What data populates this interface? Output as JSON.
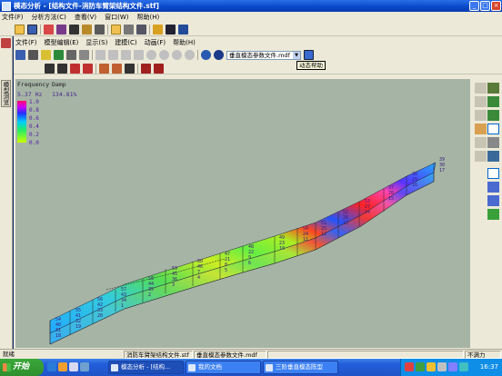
{
  "window": {
    "title": "模态分析 - [结构文件-消防车臂架结构文件.stf]"
  },
  "main_menu": [
    "文件(F)",
    "分析方法(C)",
    "查看(V)",
    "窗口(W)",
    "帮助(H)"
  ],
  "left_tab": {
    "label": "模型浏览"
  },
  "child_menu": [
    "文件(F)",
    "模型编辑(E)",
    "显示(S)",
    "建模(C)",
    "动画(F)",
    "帮助(H)"
  ],
  "mode_select": {
    "value": "垂直模态参数文件.mdf"
  },
  "tooltip": "动态帮助",
  "legend": {
    "col1": "Frequency",
    "col2": "Damp",
    "freq_value": "5.37 Hz",
    "damp_value": "134.81%",
    "ticks": [
      "1.0",
      "0.8",
      "0.6",
      "0.4",
      "0.2",
      "0.0"
    ]
  },
  "nodes": [
    "54",
    "55",
    "56",
    "57",
    "58",
    "59",
    "60",
    "47",
    "48",
    "49",
    "50",
    "51",
    "52",
    "53",
    "37",
    "38",
    "39",
    "40",
    "41",
    "42",
    "43",
    "44",
    "45",
    "46",
    "21",
    "22",
    "23",
    "24",
    "25",
    "26",
    "27",
    "28",
    "29",
    "30",
    "31",
    "32",
    "33",
    "34",
    "35",
    "36",
    "7",
    "8",
    "9",
    "10",
    "11",
    "12",
    "13",
    "14",
    "15",
    "16",
    "17",
    "18",
    "19",
    "20",
    "1",
    "2",
    "3",
    "4",
    "5",
    "6"
  ],
  "status": {
    "ready": "就绪",
    "file1": "消防车臂架结构文件.stf",
    "file2": "垂直模态参数文件.mdf",
    "mode": "不满力"
  },
  "taskbar": {
    "start": "开始",
    "tasks": [
      "模态分析 - [结构...",
      "我的文档",
      "三阶垂直模态陈型"
    ],
    "clock": "16:37"
  },
  "colors": {
    "viewport_bg": "#a6b4a6",
    "mode_high": "#ff0000",
    "mode_low": "#33ccff"
  }
}
